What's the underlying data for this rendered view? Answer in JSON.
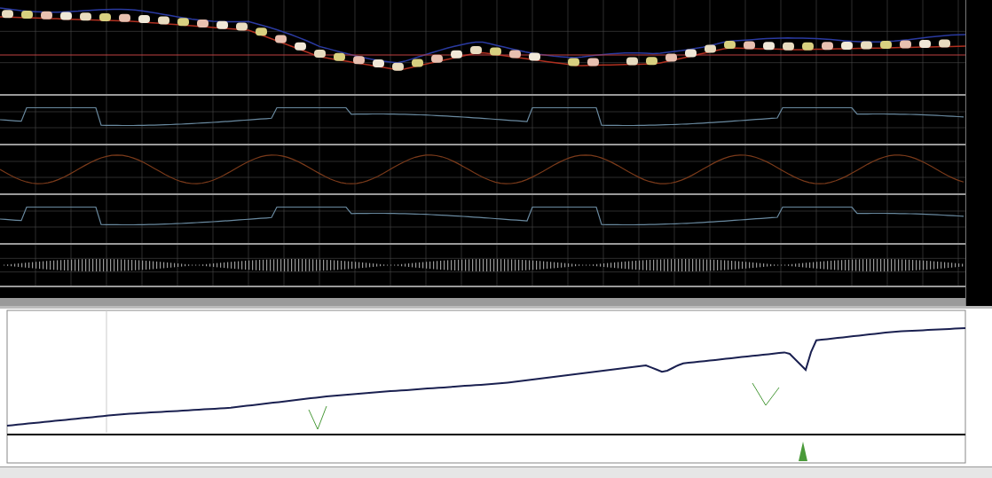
{
  "terminal": {
    "panes": [
      {
        "kind": "price"
      },
      {
        "kind": "line"
      },
      {
        "kind": "wave"
      },
      {
        "kind": "line"
      },
      {
        "kind": "histogram"
      }
    ]
  },
  "report": {
    "kind": "equity"
  }
}
